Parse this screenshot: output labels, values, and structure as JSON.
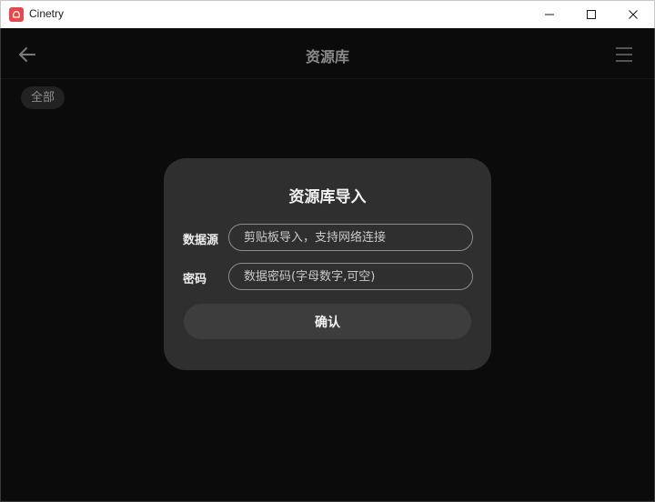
{
  "window": {
    "title": "Cinetry",
    "app_icon": "cinetry-logo-icon",
    "controls": [
      "minimize-icon",
      "maximize-icon",
      "close-icon"
    ]
  },
  "header": {
    "back_icon": "arrow-left-icon",
    "title": "资源库",
    "menu_icon": "hamburger-menu-icon"
  },
  "filters": {
    "chips": [
      {
        "label": "全部"
      }
    ]
  },
  "dialog": {
    "title": "资源库导入",
    "source": {
      "label": "数据源",
      "value": "",
      "placeholder": "剪贴板导入，支持网络连接"
    },
    "password": {
      "label": "密码",
      "value": "",
      "placeholder": "数据密码(字母数字,可空)"
    },
    "confirm_label": "确认"
  },
  "colors": {
    "background": "#0b0b0b",
    "dialog": "#2f2f2f",
    "brand": "#e5484d"
  }
}
